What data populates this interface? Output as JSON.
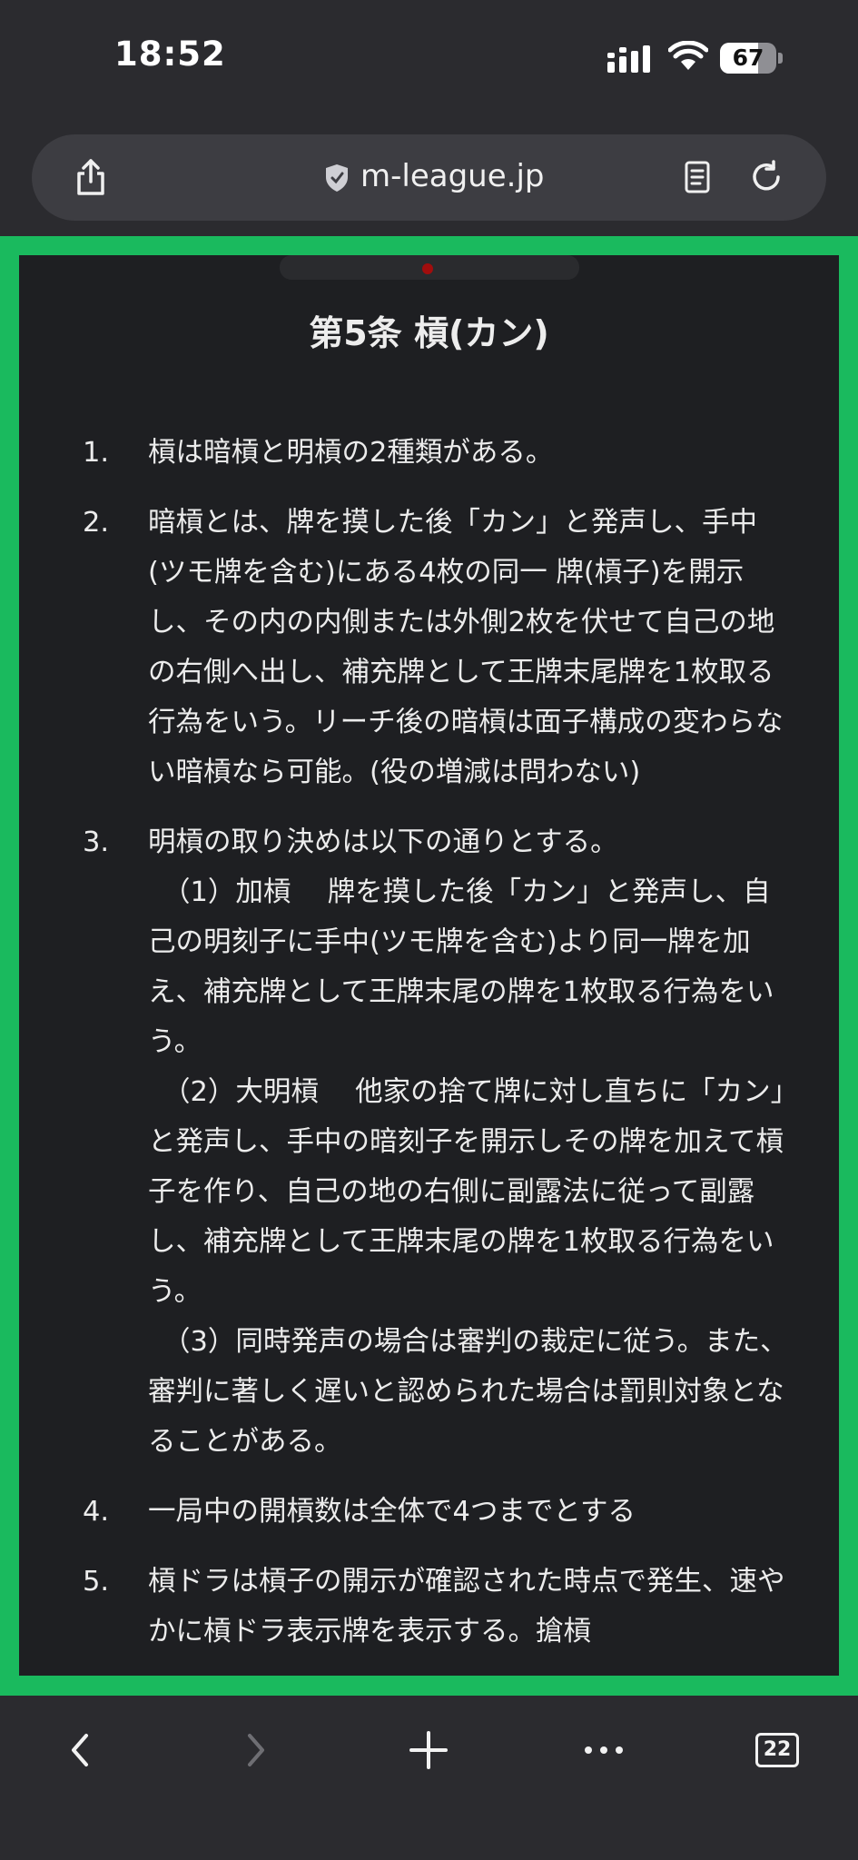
{
  "status_bar": {
    "time": "18:52",
    "battery_percent": "67",
    "battery_level": 0.67,
    "icons": [
      "cellular-signal-icon",
      "wifi-icon",
      "battery-icon"
    ]
  },
  "url_bar": {
    "domain": "m-league.jp",
    "icons": [
      "share-icon",
      "secure-shield-icon",
      "reader-mode-icon",
      "reload-icon"
    ]
  },
  "article": {
    "title": "第5条 槓(カン)",
    "items": [
      {
        "num": "1.",
        "text": "槓は暗槓と明槓の2種類がある。"
      },
      {
        "num": "2.",
        "text": "暗槓とは、牌を摸した後「カン」と発声し、手中(ツモ牌を含む)にある4枚の同一 牌(槓子)を開示し、その内の内側または外側2枚を伏せて自己の地の右側へ出し、補充牌として王牌末尾牌を1枚取る行為をいう。リーチ後の暗槓は面子構成の変わらない暗槓なら可能。(役の増減は問わない)"
      },
      {
        "num": "3.",
        "text": "明槓の取り決めは以下の通りとする。",
        "subs": [
          "（1）加槓　 牌を摸した後「カン」と発声し、自己の明刻子に手中(ツモ牌を含む)より同一牌を加え、補充牌として王牌末尾の牌を1枚取る行為をいう。",
          "（2）大明槓　 他家の捨て牌に対し直ちに「カン」と発声し、手中の暗刻子を開示しその牌を加えて槓子を作り、自己の地の右側に副露法に従って副露し、補充牌として王牌末尾の牌を1枚取る行為をいう。",
          "（3）同時発声の場合は審判の裁定に従う。また、審判に著しく遅いと認められた場合は罰則対象となることがある。"
        ]
      },
      {
        "num": "4.",
        "text": "一局中の開槓数は全体で4つまでとする"
      },
      {
        "num": "5.",
        "text": "槓ドラは槓子の開示が確認された時点で発生、速やかに槓ドラ表示牌を表示する。搶槓"
      }
    ]
  },
  "toolbar": {
    "tab_count": "22",
    "icons": [
      "back-icon",
      "forward-icon",
      "new-tab-icon",
      "more-icon",
      "tabs-icon"
    ]
  }
}
